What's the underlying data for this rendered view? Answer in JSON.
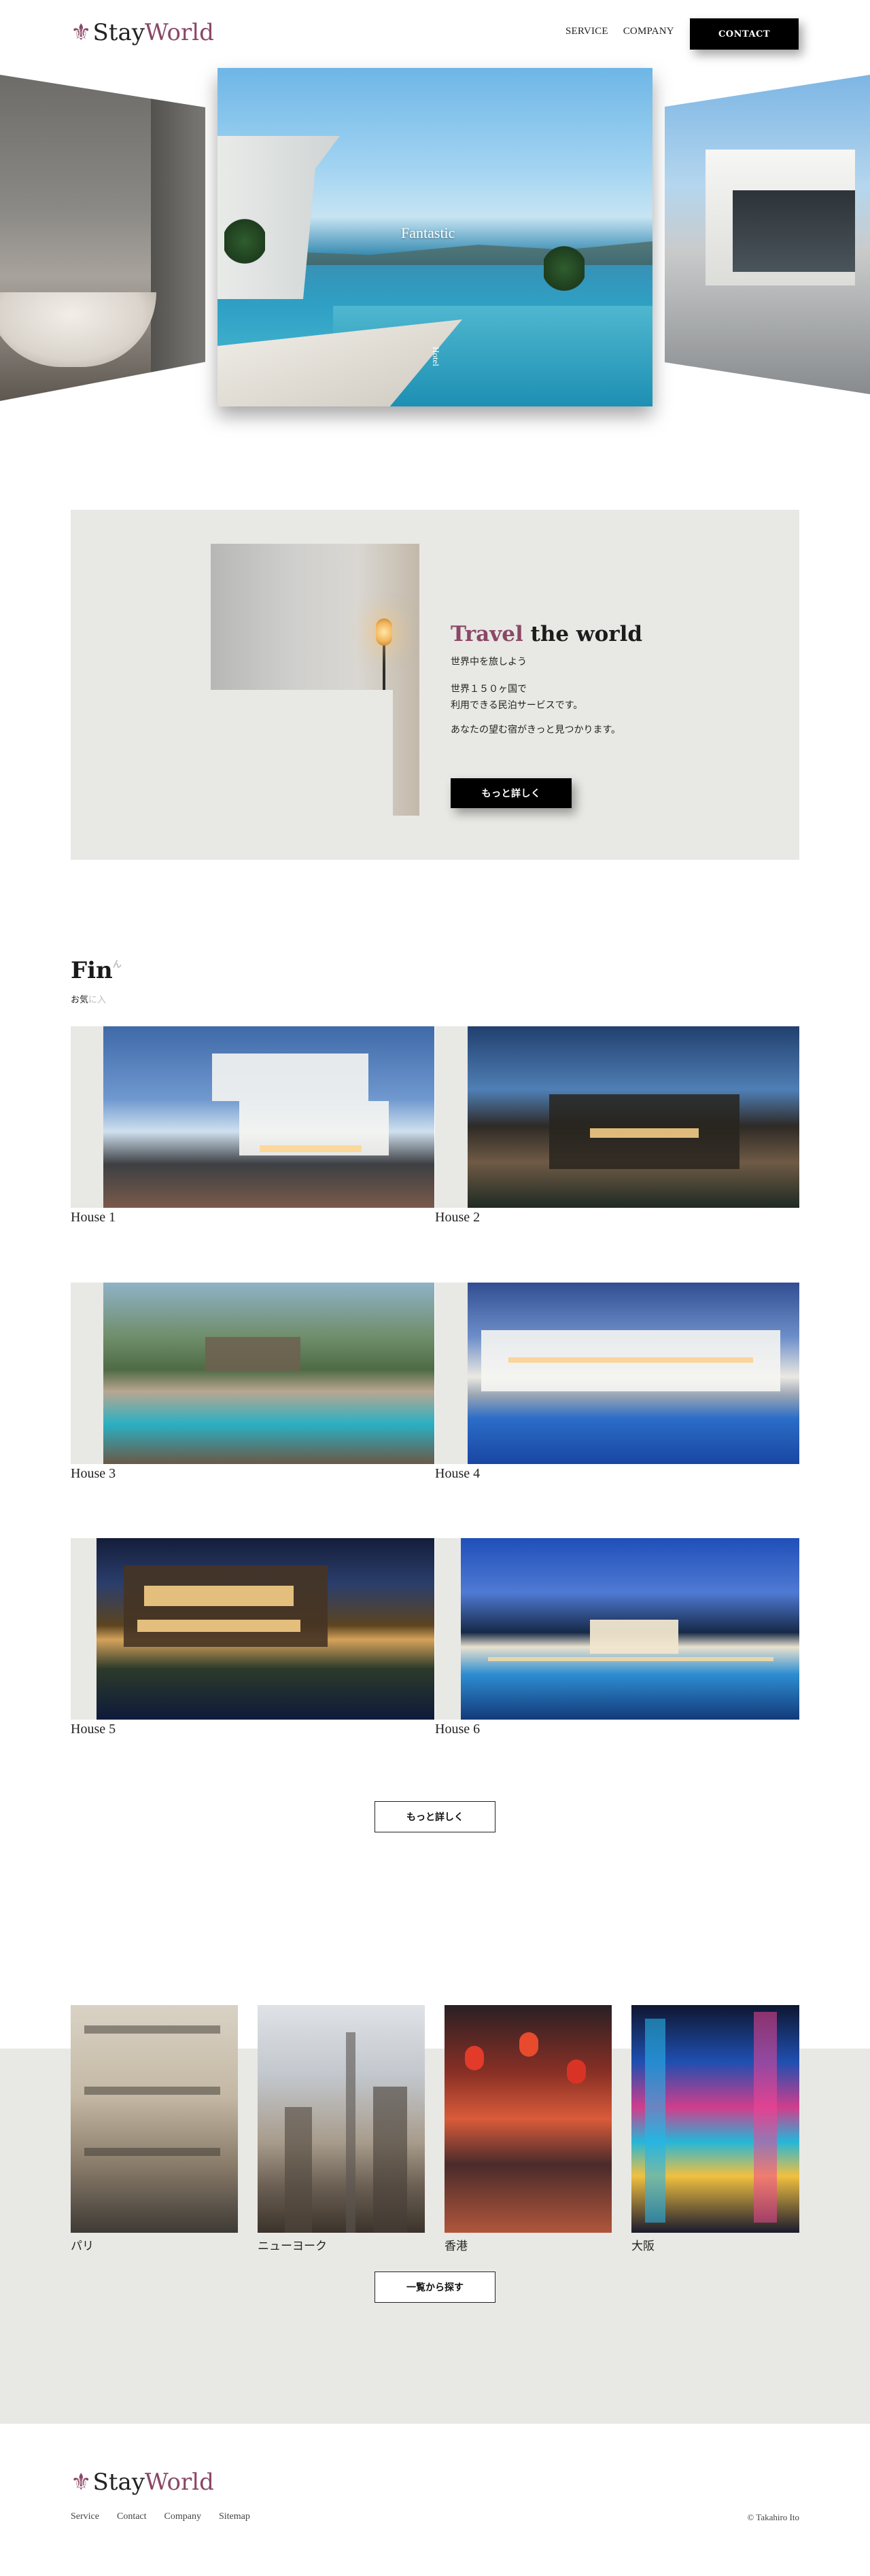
{
  "header": {
    "logo_stay": "Stay",
    "logo_world": "World",
    "nav": [
      "SERVICE",
      "COMPANY"
    ],
    "contact_label": "CONTACT"
  },
  "hero": {
    "caption": "Fantastic",
    "side_text": "Hotel"
  },
  "travel": {
    "title_accent": "Travel",
    "title_rest": " the world",
    "subtitle": "世界中を旅しよう",
    "body_line1": "世界１５０ヶ国で",
    "body_line2": "利用できる民泊サービスです。",
    "body_line3": "あなたの望む宿がきっと見つかります。",
    "button_label": "もっと詳しく"
  },
  "houses": {
    "title": "Fin",
    "title_fade": "ん",
    "subtitle": "お気",
    "subtitle_fade": "に入",
    "items": [
      {
        "label": "House 1"
      },
      {
        "label": "House 2"
      },
      {
        "label": "House 3"
      },
      {
        "label": "House 4"
      },
      {
        "label": "House 5"
      },
      {
        "label": "House 6"
      }
    ],
    "more_label": "もっと詳しく"
  },
  "cities": {
    "items": [
      {
        "label": "パリ"
      },
      {
        "label": "ニューヨーク"
      },
      {
        "label": "香港"
      },
      {
        "label": "大阪"
      }
    ],
    "list_label": "一覧から探す"
  },
  "footer": {
    "logo_stay": "Stay",
    "logo_world": "World",
    "links": [
      "Service",
      "Contact",
      "Company",
      "Sitemap"
    ],
    "copyright": "© Takahiro Ito"
  },
  "colors": {
    "accent": "#8a4766",
    "panel": "#e8e8e4",
    "black": "#000000"
  }
}
